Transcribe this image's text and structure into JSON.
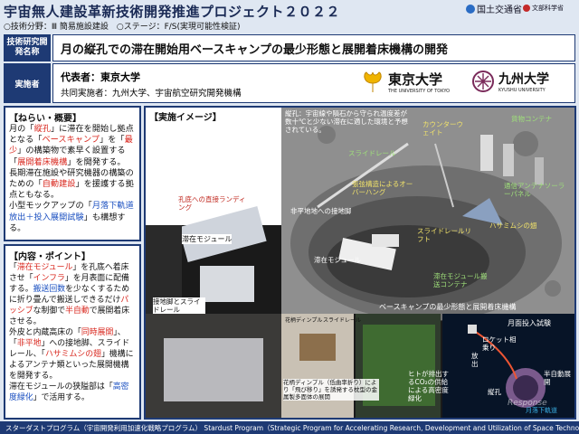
{
  "header": {
    "title": "宇宙無人建設革新技術開発推進プロジェクト２０２２",
    "mlit": "国土交通省",
    "mext": "文部科学省",
    "meta_line": "○技術分野：Ⅲ 簡易施設建設　○ステージ：F/S(実現可能性検証)"
  },
  "labels": {
    "tech_name_tag": "技術研究開発名称",
    "implementer_tag": "実施者"
  },
  "project": {
    "title": "月の縦孔での滞在開始用ベースキャンプの最少形態と展開着床機構の開発",
    "rep_label": "代表者：",
    "rep_name": "東京大学",
    "co_label": "共同実施者：",
    "co_names": "九州大学、宇宙航空研究開発機構"
  },
  "logos": {
    "utokyo_jp": "東京大学",
    "utokyo_en": "THE UNIVERSITY OF TOKYO",
    "kyushu_jp": "九州大学",
    "kyushu_en": "KYUSHU UNIVERSITY"
  },
  "aim": {
    "heading": "【ねらい・概要】",
    "p1_a": "月の「",
    "p1_b": "縦孔",
    "p1_c": "」に滞在を開始し拠点となる「",
    "p1_d": "ベースキャンプ",
    "p1_e": "」を「",
    "p1_f": "最少",
    "p1_g": "」の構築物で素早く設置する「",
    "p1_h": "展開着床機構",
    "p1_i": "」を開発する。",
    "p2_a": "長期滞在施設や研究機器の構築のための「",
    "p2_b": "自動建設",
    "p2_c": "」を援護する拠点ともなる。",
    "p3_a": "小型モックアップの「",
    "p3_b": "月落下軌道放出＋投入展開試験",
    "p3_c": "」も構想する。"
  },
  "content": {
    "heading": "【内容・ポイント】",
    "s1": "「",
    "s2": "滞在モジュール",
    "s3": "」を孔底へ着床させ「",
    "s4": "インフラ",
    "s5": "」を月表面に配備する。",
    "s6": "搬送回数",
    "s7": "を少なくするために折り畳んで搬送しできるだけ",
    "s8": "パッシブ",
    "s9": "な制御で",
    "s10": "半自動",
    "s11": "で展開着床させる。",
    "s12": "外皮と内蔵高床の「",
    "s13": "同時展開",
    "s14": "」、「",
    "s15": "非平地",
    "s16": "」への接地脚、スライドレール、「",
    "s17": "ハサミムシの翅",
    "s18": "」機構によるアンテナ類といった展開機構を開発する。",
    "s19": "滞在モジュールの狭隘部は「",
    "s20": "高密度緑化",
    "s21": "」で活用する。"
  },
  "image_panel": {
    "heading": "【実施イメージ】",
    "lbl_pit_landing": "孔底への直接ランディング",
    "lbl_stay_module": "滞在モジュール",
    "lbl_leg_rail": "接地脚とスライドレール",
    "lbl_shelter": "縦孔：宇宙線や隕石から守られ温度差が数十℃と少ない滞在に適した環境と予想されている。",
    "lbl_counterweight": "カウンターウェイト",
    "lbl_cargo": "貨物コンテナ",
    "lbl_slide_rail": "スライドレール",
    "lbl_overhang": "張弦構造によるオーバーハング",
    "lbl_nonflat": "非平地地への接地脚",
    "lbl_antenna": "通信アンテナソーラーパネル",
    "lbl_earwig": "ハサミムシの翅",
    "lbl_module": "滞在モジュール",
    "lbl_rail_lift": "スライドレールリフト",
    "lbl_transport": "滞在モジュール搬送コンテナ",
    "lbl_caption": "ベースキャンプの最少形態と展開着床機構",
    "lbl_flower": "花柄ディンプル（低曲率折り）により「飛び移り」を誘発する枕型の金属製多面体の展開",
    "lbl_greening": "ヒトが排出するCO₂の供給による高密度緑化",
    "lbl_test": "月面投入試験",
    "lbl_rocket": "ロケット相乗り",
    "lbl_release": "放出",
    "lbl_semi": "半自動展開",
    "lbl_pit": "縦孔",
    "lbl_moon": "月落下軌道",
    "lbl_flower_small": "花柄ディンプル",
    "lbl_slide_small": "スライドレール"
  },
  "footer": {
    "text": "スターダストプログラム（宇宙開発利用加速化戦略プログラム） Stardust Program（Strategic Program for Accelerating Research, Development and Utilization of Space Technology）"
  },
  "watermark": "Response"
}
